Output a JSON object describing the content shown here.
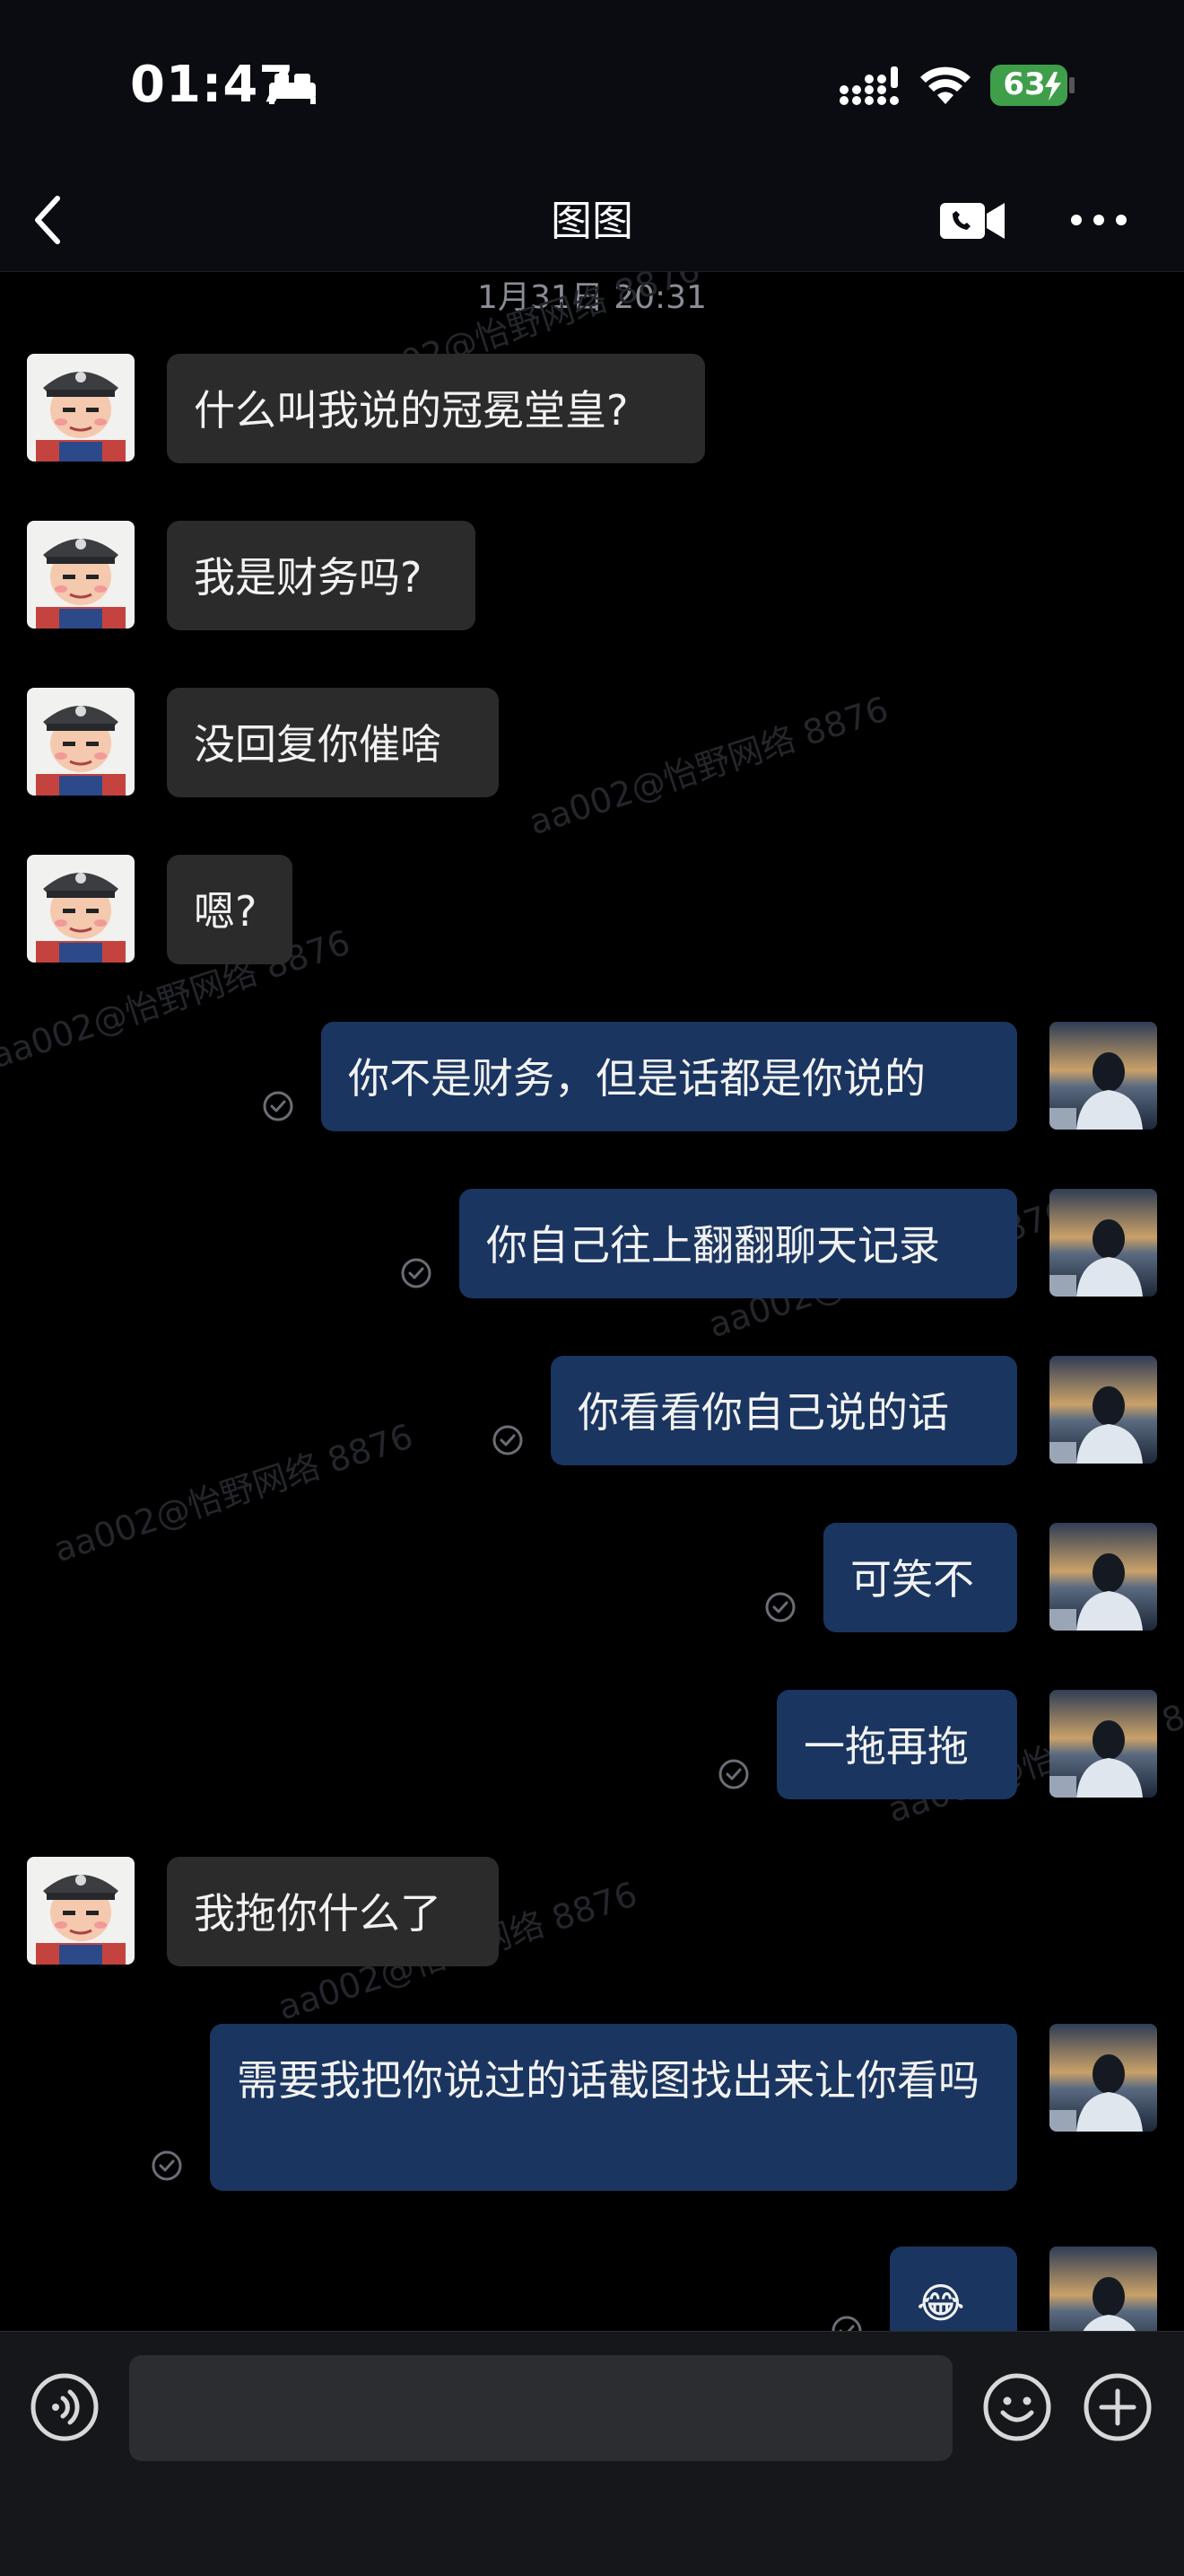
{
  "status_bar": {
    "time": "01:47",
    "battery": "63"
  },
  "header": {
    "title": "图图"
  },
  "chat": {
    "timestamp": "1月31日 20:31",
    "watermark": "aa002@怡野网络 8876",
    "messages": [
      {
        "side": "in",
        "text": "什么叫我说的冠冕堂皇?"
      },
      {
        "side": "in",
        "text": "我是财务吗?"
      },
      {
        "side": "in",
        "text": "没回复你催啥"
      },
      {
        "side": "in",
        "text": "嗯?"
      },
      {
        "side": "out",
        "text": "你不是财务，但是话都是你说的"
      },
      {
        "side": "out",
        "text": "你自己往上翻翻聊天记录"
      },
      {
        "side": "out",
        "text": "你看看你自己说的话"
      },
      {
        "side": "out",
        "text": "可笑不"
      },
      {
        "side": "out",
        "text": "一拖再拖"
      },
      {
        "side": "in",
        "text": "我拖你什么了"
      },
      {
        "side": "out",
        "text": "需要我把你说过的话截图找出来让你看吗"
      },
      {
        "side": "out",
        "text": "😂"
      }
    ]
  },
  "input_bar": {
    "placeholder": ""
  },
  "icons": {
    "back": "chevron-left-icon",
    "video_call": "video-call-icon",
    "more": "more-icon",
    "voice": "voice-icon",
    "emoji": "emoji-icon",
    "add": "plus-icon"
  },
  "colors": {
    "incoming_bubble": "#2b2b2b",
    "outgoing_bubble": "#1a3560",
    "background": "#000000"
  }
}
